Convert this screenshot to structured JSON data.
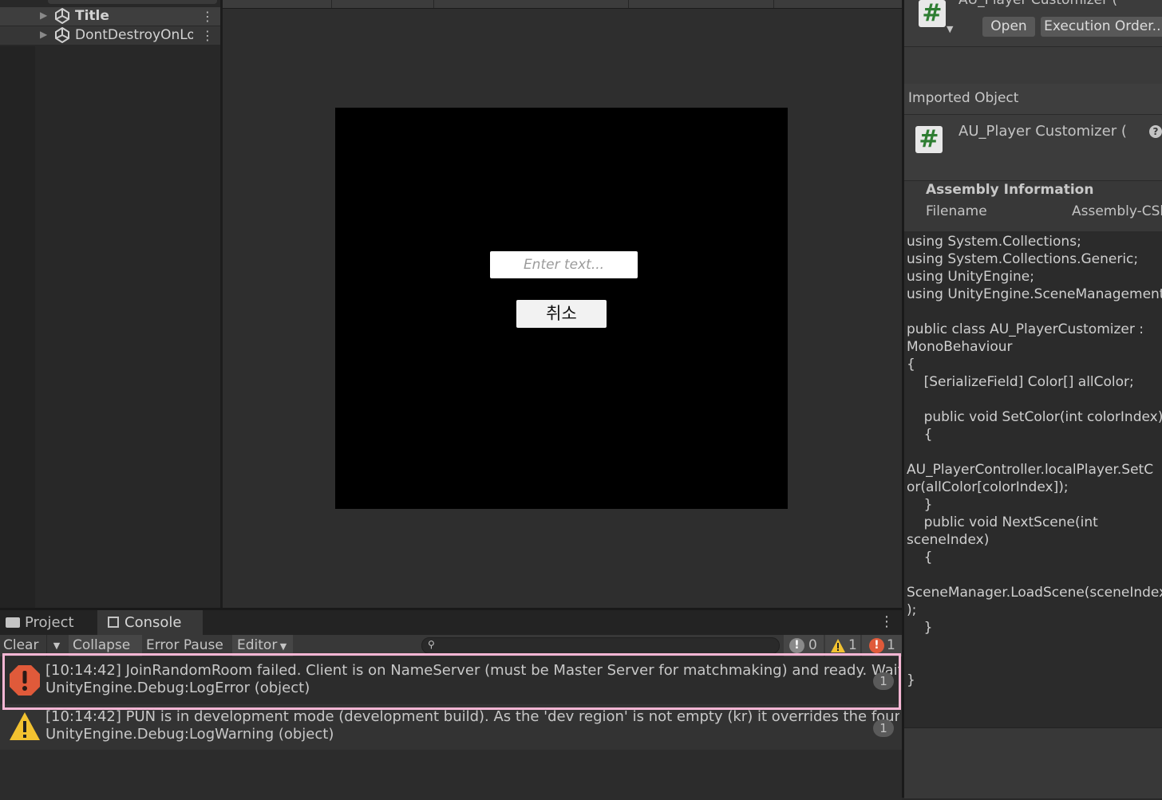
{
  "hierarchy": {
    "items": [
      {
        "label": "Title"
      },
      {
        "label": "DontDestroyOnLoad"
      }
    ]
  },
  "game": {
    "input_placeholder": "Enter text...",
    "cancel_button": "취소"
  },
  "inspector": {
    "title": "AU_Player Customizer (",
    "open_button": "Open",
    "execution_order_button": "Execution Order...",
    "imported_object_label": "Imported Object",
    "asset_name": "AU_Player Customizer (",
    "assembly_heading": "Assembly Information",
    "filename_label": "Filename",
    "filename_value": "Assembly-CSharp.dll",
    "code": "using System.Collections;\nusing System.Collections.Generic;\nusing UnityEngine;\nusing UnityEngine.SceneManagement;\n\npublic class AU_PlayerCustomizer :\nMonoBehaviour\n{\n    [SerializeField] Color[] allColor;\n\n    public void SetColor(int colorIndex)\n    {\n\nAU_PlayerController.localPlayer.SetC\nor(allColor[colorIndex]);\n    }\n    public void NextScene(int\nsceneIndex)\n    {\n\nSceneManager.LoadScene(sceneIndex\n);\n    }\n\n\n}"
  },
  "console": {
    "tabs": [
      {
        "label": "Project"
      },
      {
        "label": "Console"
      }
    ],
    "toolbar": {
      "clear": "Clear",
      "collapse": "Collapse",
      "error_pause": "Error Pause",
      "editor": "Editor"
    },
    "counts": {
      "info": "0",
      "warnings": "1",
      "errors": "1"
    },
    "logs": [
      {
        "type": "error",
        "line1": "[10:14:42] JoinRandomRoom failed. Client is on NameServer (must be Master Server for matchmaking) and ready. Wait for callback",
        "line2": "UnityEngine.Debug:LogError (object)",
        "count": "1"
      },
      {
        "type": "warning",
        "line1": "[10:14:42] PUN is in development mode (development build). As the 'dev region' is not empty (kr) it overrides the found best",
        "line2": "UnityEngine.Debug:LogWarning (object)",
        "count": "1"
      }
    ]
  },
  "colors": {
    "error": "#e05a3a",
    "warning": "#f2c230",
    "highlight": "#f6b6d4"
  }
}
